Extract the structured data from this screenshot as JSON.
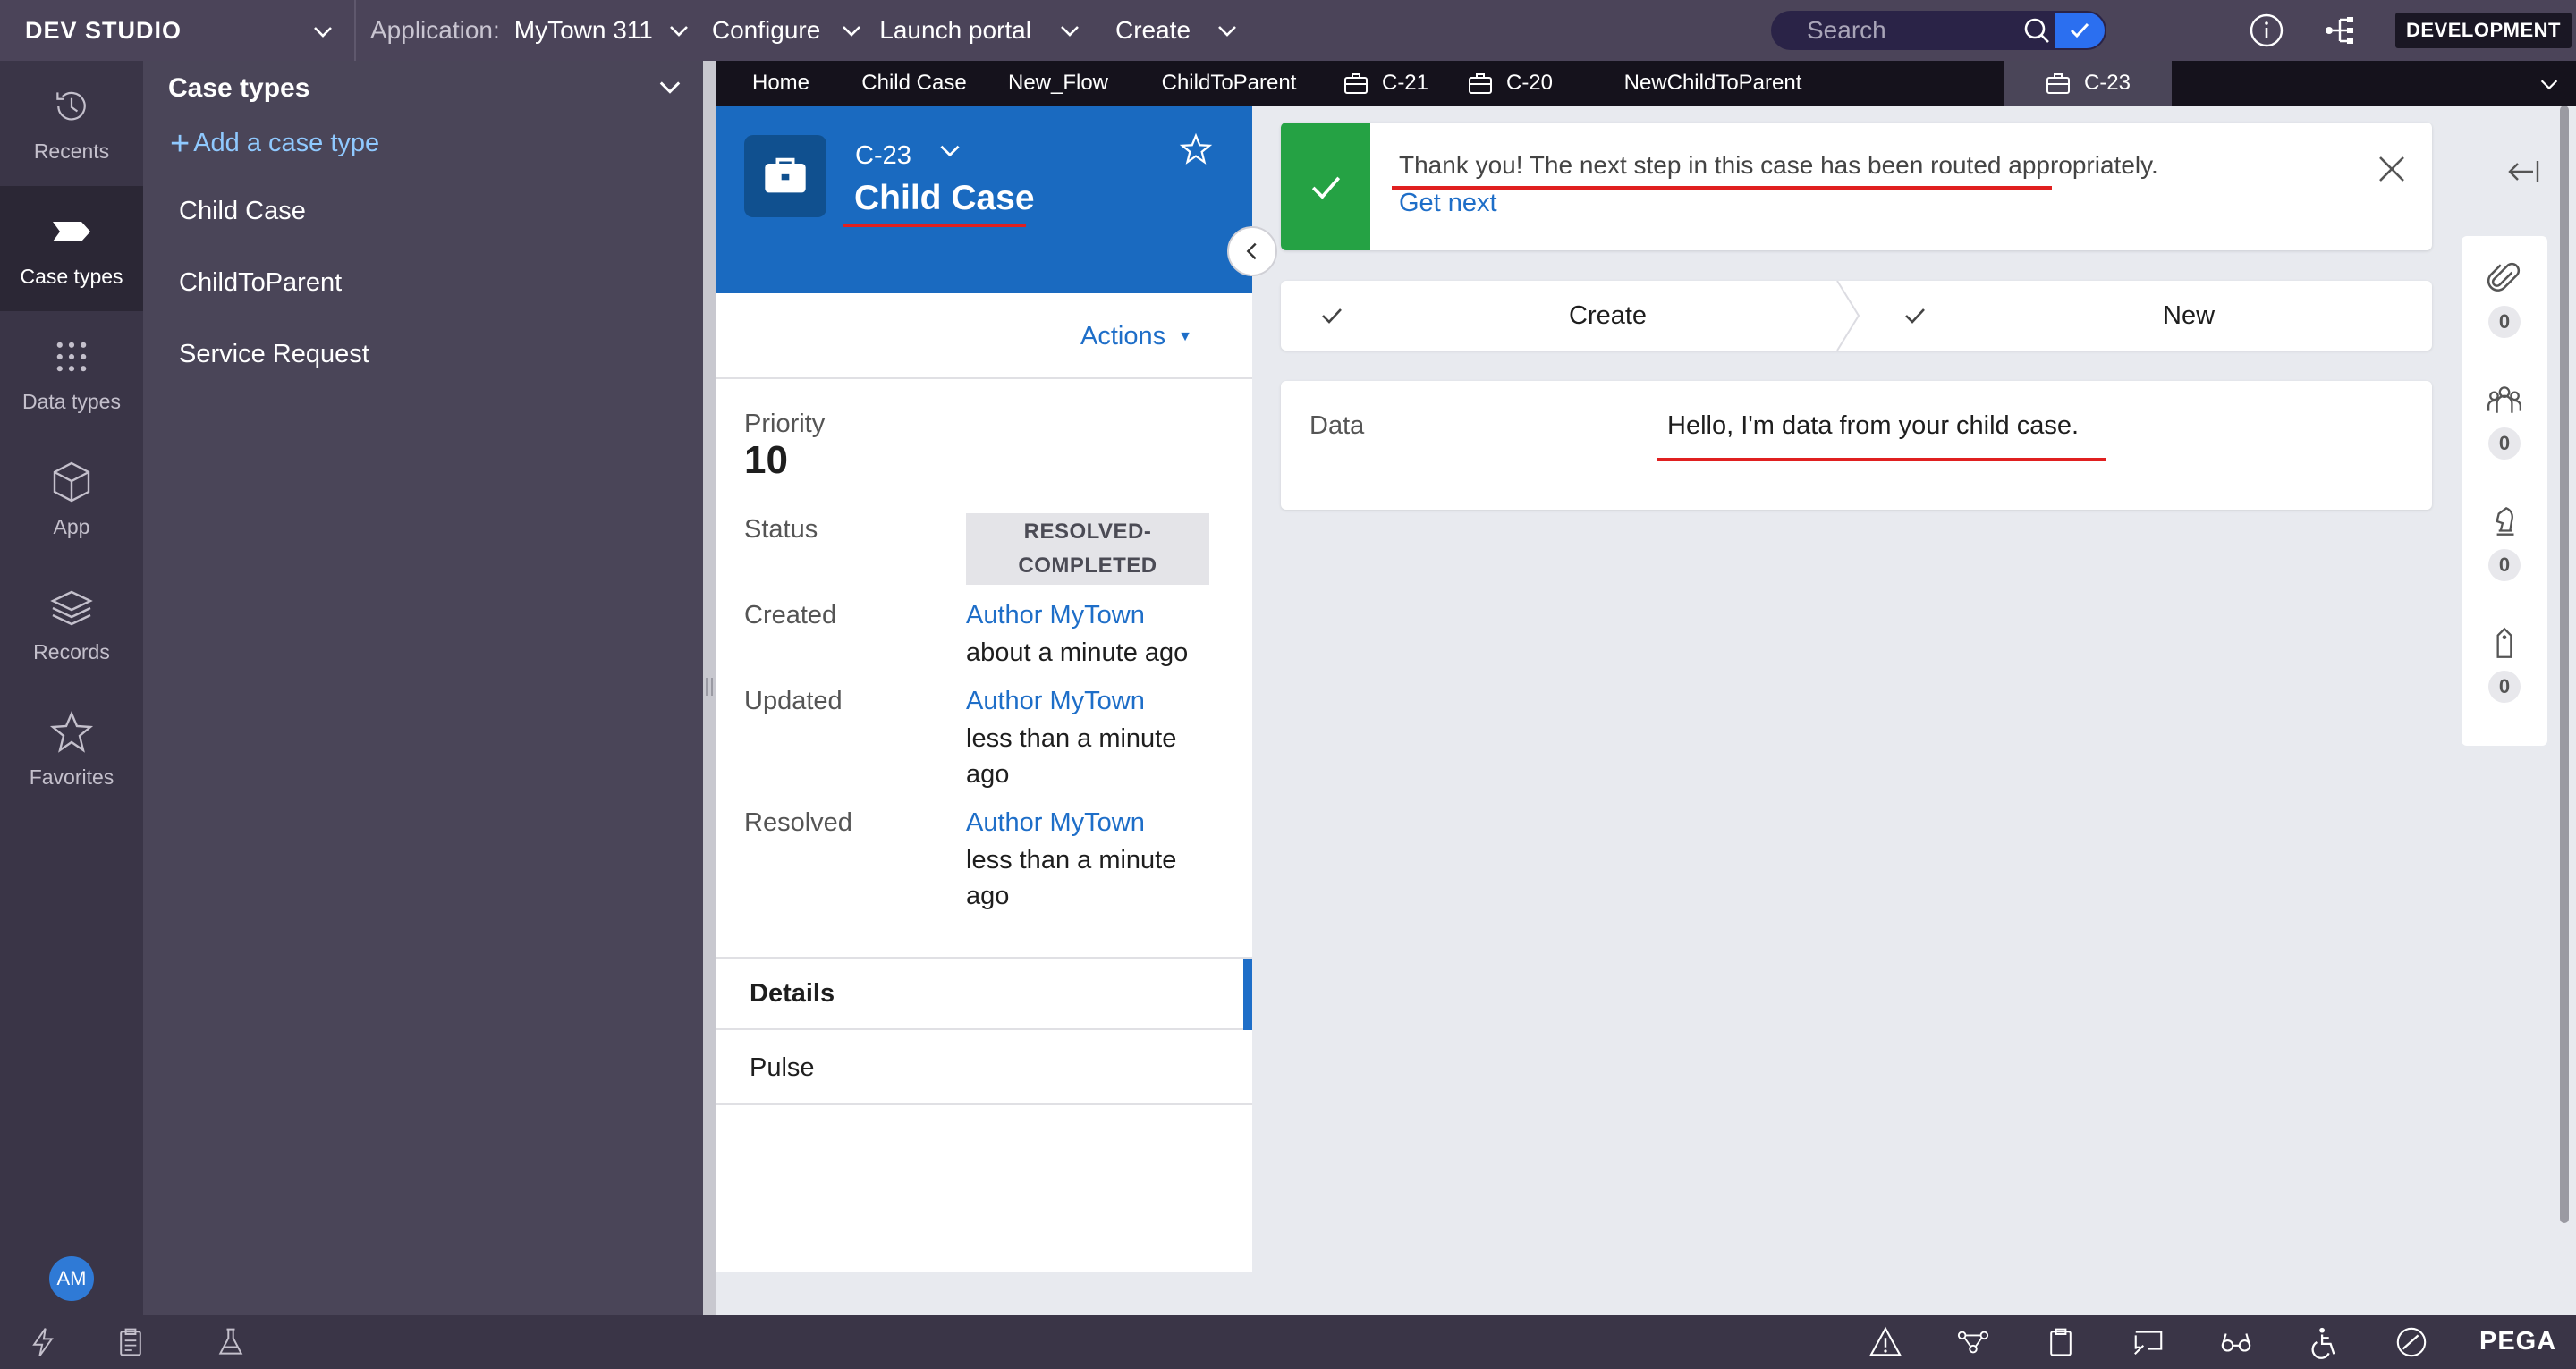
{
  "topbar": {
    "brand": "DEV STUDIO",
    "application_label": "Application:",
    "application_name": "MyTown 311",
    "configure": "Configure",
    "launch_portal": "Launch portal",
    "create": "Create",
    "search_placeholder": "Search",
    "environment": "DEVELOPMENT"
  },
  "leftnav": {
    "items": [
      {
        "label": "Recents",
        "icon": "history-icon"
      },
      {
        "label": "Case types",
        "icon": "case-types-icon"
      },
      {
        "label": "Data types",
        "icon": "grid-dots-icon"
      },
      {
        "label": "App",
        "icon": "cube-icon"
      },
      {
        "label": "Records",
        "icon": "layers-icon"
      },
      {
        "label": "Favorites",
        "icon": "star-icon"
      }
    ],
    "avatar": "AM"
  },
  "explorer": {
    "title": "Case types",
    "add_label": "Add a case type",
    "case_types": [
      "Child Case",
      "ChildToParent",
      "Service Request"
    ]
  },
  "tabs": [
    {
      "label": "Home"
    },
    {
      "label": "Child Case"
    },
    {
      "label": "New_Flow"
    },
    {
      "label": "ChildToParent"
    },
    {
      "label": "C-21"
    },
    {
      "label": "C-20"
    },
    {
      "label": "NewChildToParent"
    },
    {
      "label": "C-23"
    }
  ],
  "case": {
    "id": "C-23",
    "name": "Child Case",
    "actions": "Actions",
    "priority_label": "Priority",
    "priority_value": "10",
    "status_label": "Status",
    "status_line1": "RESOLVED-",
    "status_line2": "COMPLETED",
    "created_label": "Created",
    "created_by": "Author MyTown",
    "created_when": "about a minute ago",
    "updated_label": "Updated",
    "updated_by": "Author MyTown",
    "updated_when": "less than a minute ago",
    "resolved_label": "Resolved",
    "resolved_by": "Author MyTown",
    "resolved_when": "less than a minute ago",
    "tab_details": "Details",
    "tab_pulse": "Pulse"
  },
  "banner": {
    "message": "Thank you! The next step in this case has been routed appropriately.",
    "get_next": "Get next"
  },
  "stages": [
    {
      "label": "Create"
    },
    {
      "label": "New"
    }
  ],
  "data_card": {
    "label": "Data",
    "value": "Hello, I'm data from your child case."
  },
  "utility_rail": [
    {
      "icon": "paperclip-icon",
      "count": "0"
    },
    {
      "icon": "people-icon",
      "count": "0"
    },
    {
      "icon": "chess-knight-icon",
      "count": "0"
    },
    {
      "icon": "tag-icon",
      "count": "0"
    }
  ],
  "bottombar": {
    "brand": "PEGA"
  },
  "colors": {
    "topbar": "#4b4459",
    "case_header": "#1a6ac0",
    "success": "#25a244",
    "link": "#1e6ec8",
    "highlight_underline": "#e02020"
  }
}
